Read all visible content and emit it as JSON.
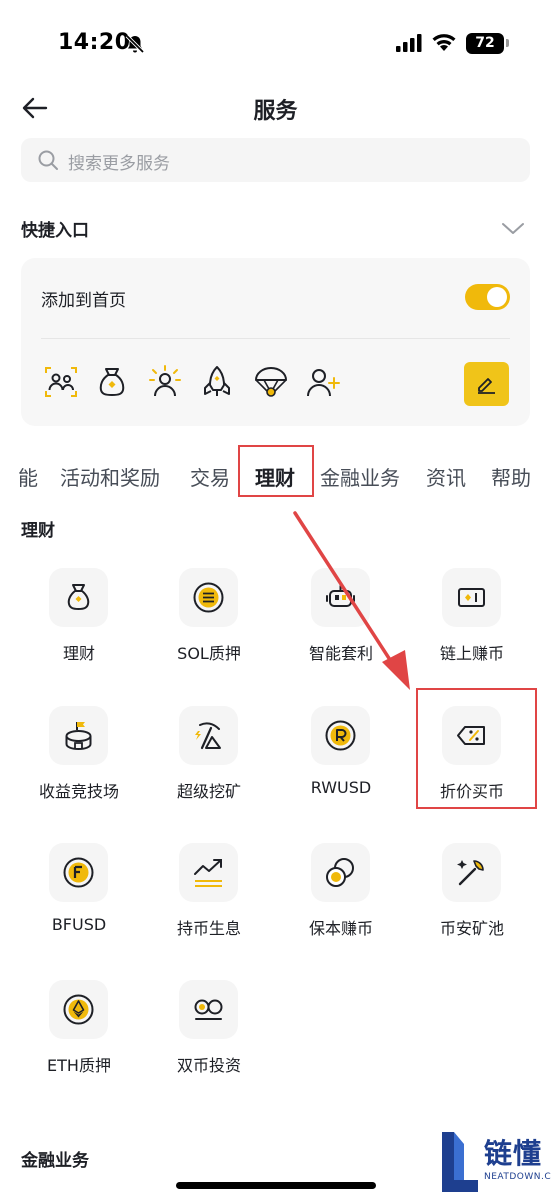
{
  "status_bar": {
    "time": "14:20",
    "battery": "72"
  },
  "header": {
    "title": "服务"
  },
  "search": {
    "placeholder": "搜索更多服务"
  },
  "quick_access": {
    "title": "快捷入口",
    "add_to_home": "添加到首页",
    "toggle_on": true,
    "icons": [
      "id-card-icon",
      "money-bag-icon",
      "sun-person-icon",
      "rocket-icon",
      "parachute-icon",
      "add-user-icon"
    ]
  },
  "tabs": [
    {
      "label": "能",
      "active": false
    },
    {
      "label": "活动和奖励",
      "active": false
    },
    {
      "label": "交易",
      "active": false
    },
    {
      "label": "理财",
      "active": true
    },
    {
      "label": "金融业务",
      "active": false
    },
    {
      "label": "资讯",
      "active": false
    },
    {
      "label": "帮助",
      "active": false
    }
  ],
  "section_wealth": {
    "title": "理财",
    "items": [
      {
        "label": "理财",
        "icon": "money-bag-icon"
      },
      {
        "label": "SOL质押",
        "icon": "sol-coin-icon"
      },
      {
        "label": "智能套利",
        "icon": "robot-icon"
      },
      {
        "label": "链上赚币",
        "icon": "onchain-icon"
      },
      {
        "label": "收益竞技场",
        "icon": "arena-icon"
      },
      {
        "label": "超级挖矿",
        "icon": "pickaxe-icon"
      },
      {
        "label": "RWUSD",
        "icon": "rwusd-coin-icon"
      },
      {
        "label": "折价买币",
        "icon": "discount-tag-icon"
      },
      {
        "label": "BFUSD",
        "icon": "bfusd-coin-icon"
      },
      {
        "label": "持币生息",
        "icon": "trend-up-icon"
      },
      {
        "label": "保本赚币",
        "icon": "coins-icon"
      },
      {
        "label": "币安矿池",
        "icon": "mining-pool-icon"
      },
      {
        "label": "ETH质押",
        "icon": "eth-coin-icon"
      },
      {
        "label": "双币投资",
        "icon": "dual-coin-icon"
      }
    ]
  },
  "section_finance": {
    "title": "金融业务"
  },
  "watermark": {
    "text": "链懂",
    "sub": "NEATDOWN.COM"
  },
  "colors": {
    "accent": "#f0b90b",
    "annotation": "#e04545",
    "text": "#1e2026"
  }
}
